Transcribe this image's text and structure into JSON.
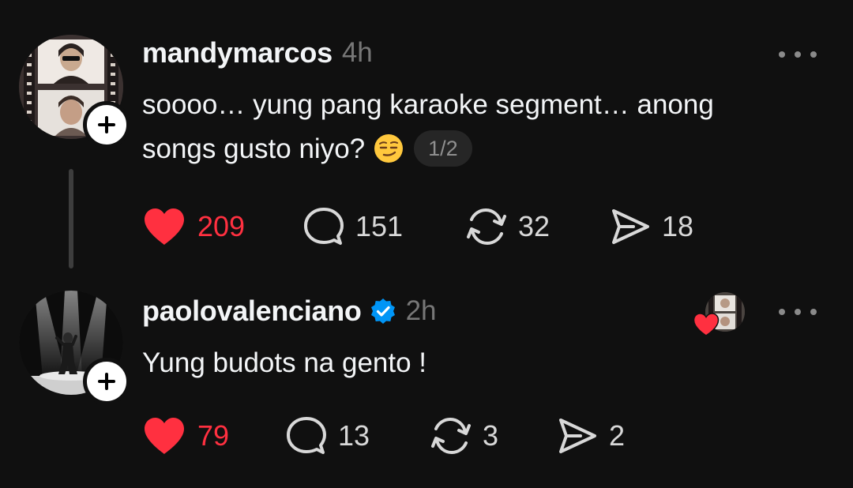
{
  "posts": [
    {
      "username": "mandymarcos",
      "time": "4h",
      "text_line1": "soooo… yung pang karaoke segment… anong",
      "text_line2": "songs gusto niyo?",
      "emoji": "smirking-face",
      "page_indicator": "1/2",
      "likes": "209",
      "liked": true,
      "replies": "151",
      "reposts": "32",
      "shares": "18"
    },
    {
      "username": "paolovalenciano",
      "verified": true,
      "time": "2h",
      "text": "Yung budots na gento !",
      "likes": "79",
      "liked": true,
      "replies": "13",
      "reposts": "3",
      "shares": "2"
    }
  ],
  "icons": {
    "like": "heart-icon",
    "reply": "comment-bubble-icon",
    "repost": "repost-arrows-icon",
    "share": "send-arrow-icon",
    "more": "more-dots-icon",
    "follow": "plus-icon",
    "verified": "verified-badge-icon"
  },
  "colors": {
    "background": "#101010",
    "like_red": "#ff3040",
    "verified_blue": "#0095f6",
    "muted": "#777777"
  }
}
